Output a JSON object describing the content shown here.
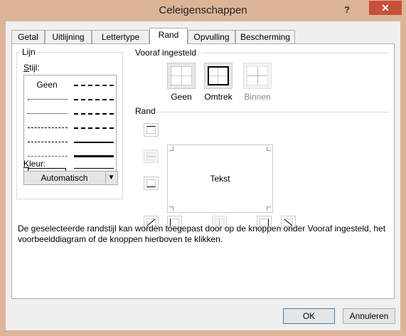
{
  "window": {
    "title": "Celeigenschappen",
    "help_label": "?",
    "close_label": "✕"
  },
  "tabs": [
    {
      "label": "Getal"
    },
    {
      "label": "Uitlijning"
    },
    {
      "label": "Lettertype"
    },
    {
      "label": "Rand",
      "active": true
    },
    {
      "label": "Opvulling"
    },
    {
      "label": "Bescherming"
    }
  ],
  "line_group": {
    "label": "Lijn",
    "style_label": "Stijl:",
    "none_label": "Geen",
    "color_label": "Kleur:",
    "color_value": "Automatisch"
  },
  "presets": {
    "label": "Vooraf ingesteld",
    "items": [
      {
        "label": "Geen",
        "enabled": true
      },
      {
        "label": "Omtrek",
        "enabled": true
      },
      {
        "label": "Binnen",
        "enabled": false
      }
    ]
  },
  "border": {
    "label": "Rand",
    "preview_text": "Tekst"
  },
  "description": "De geselecteerde randstijl kan worden toegepast door op de knoppen onder Vooraf ingesteld, het voorbeelddiagram of de knoppen hierboven te klikken.",
  "buttons": {
    "ok": "OK",
    "cancel": "Annuleren"
  },
  "colors": {
    "title_bar": "#dcb497",
    "close_button": "#c7503a",
    "dialog_bg": "#f0f0f0"
  }
}
